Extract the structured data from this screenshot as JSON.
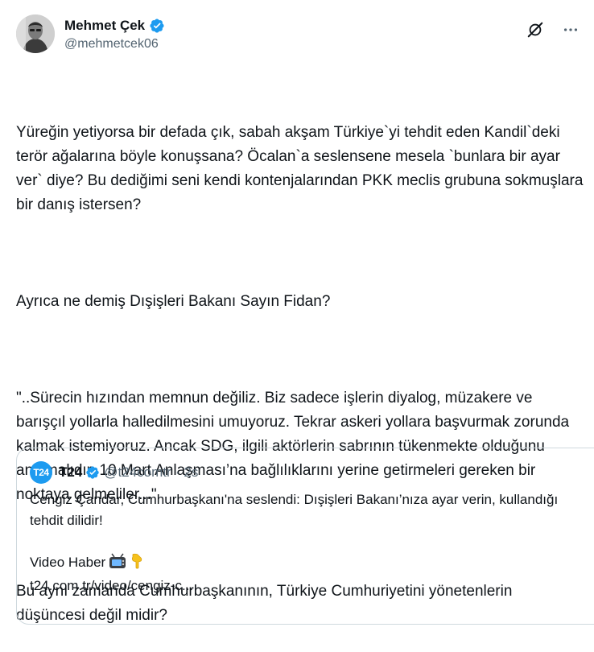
{
  "author": {
    "display_name": "Mehmet Çek",
    "handle": "@mehmetcek06"
  },
  "header_icons": [
    "grok-icon",
    "more-icon"
  ],
  "tweet": {
    "paragraphs": [
      "Yüreğin yetiyorsa bir defada çık, sabah akşam Türkiye`yi tehdit eden Kandil`deki terör ağalarına böyle konuşsana? Öcalan`a seslensene mesela `bunlara bir ayar ver` diye? Bu dediğimi seni kendi kontenjalarından PKK meclis grubuna sokmuşlara bir danış istersen?",
      "Ayrıca ne demiş Dışişleri Bakanı Sayın Fidan?",
      "\"..Sürecin hızından memnun değiliz. Biz sadece işlerin diyalog, müzakere ve barışçıl yollarla halledilmesini umuyoruz. Tekrar askeri yollara başvurmak zorunda kalmak istemiyoruz. Ancak SDG, ilgili aktörlerin sabrının tükenmekte olduğunu anlamalıdır. 10 Mart Anlaşması’na bağlılıklarını yerine getirmeleri gereken bir noktaya gelmeliler...\"",
      "Bu aynı zamanda Cumhurbaşkanının, Türkiye Cumhuriyetini yönetenlerin düşüncesi değil midir?"
    ]
  },
  "quote": {
    "logo_text": "T24",
    "display_name": "T24",
    "handle": "@t24comtr",
    "separator": "·",
    "time": "2s",
    "text_line1": "Cengiz Çandar, Cumhurbaşkanı'na seslendi: Dışişleri Bakanı’nıza ayar verin, kullandığı tehdit dilidir!",
    "text_line2": "Video Haber",
    "link": "t24.com.tr/video/cengiz-c...",
    "emojis": [
      "tv-icon",
      "pointing-down-icon"
    ]
  },
  "colors": {
    "text": "#0f1419",
    "secondary": "#536471",
    "verified": "#1d9bf0",
    "border": "#cfd9de"
  }
}
